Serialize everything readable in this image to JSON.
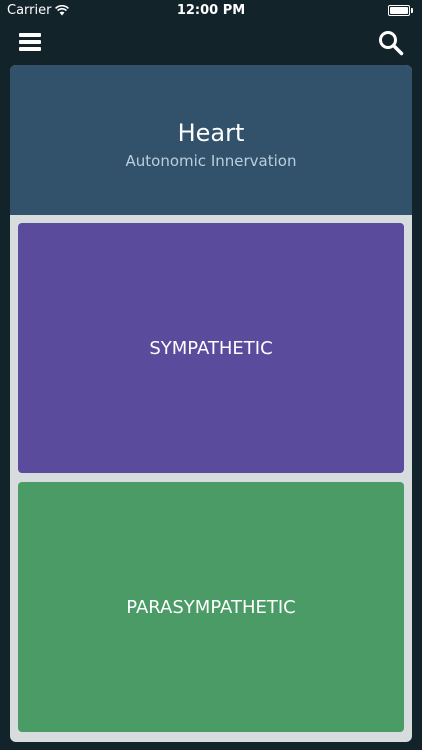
{
  "status_bar": {
    "carrier": "Carrier",
    "time": "12:00 PM",
    "battery_level": 1.0
  },
  "nav": {
    "menu_icon": "hamburger-menu-icon",
    "search_icon": "search-icon"
  },
  "card": {
    "title": "Heart",
    "subtitle": "Autonomic Innervation",
    "options": [
      {
        "label": "SYMPATHETIC",
        "color": "#5a4b9c"
      },
      {
        "label": "PARASYMPATHETIC",
        "color": "#4a9b66"
      }
    ]
  },
  "colors": {
    "background": "#12232a",
    "header": "#32516a",
    "card_frame": "#d7dcde",
    "subtitle": "#b8cfe0"
  }
}
